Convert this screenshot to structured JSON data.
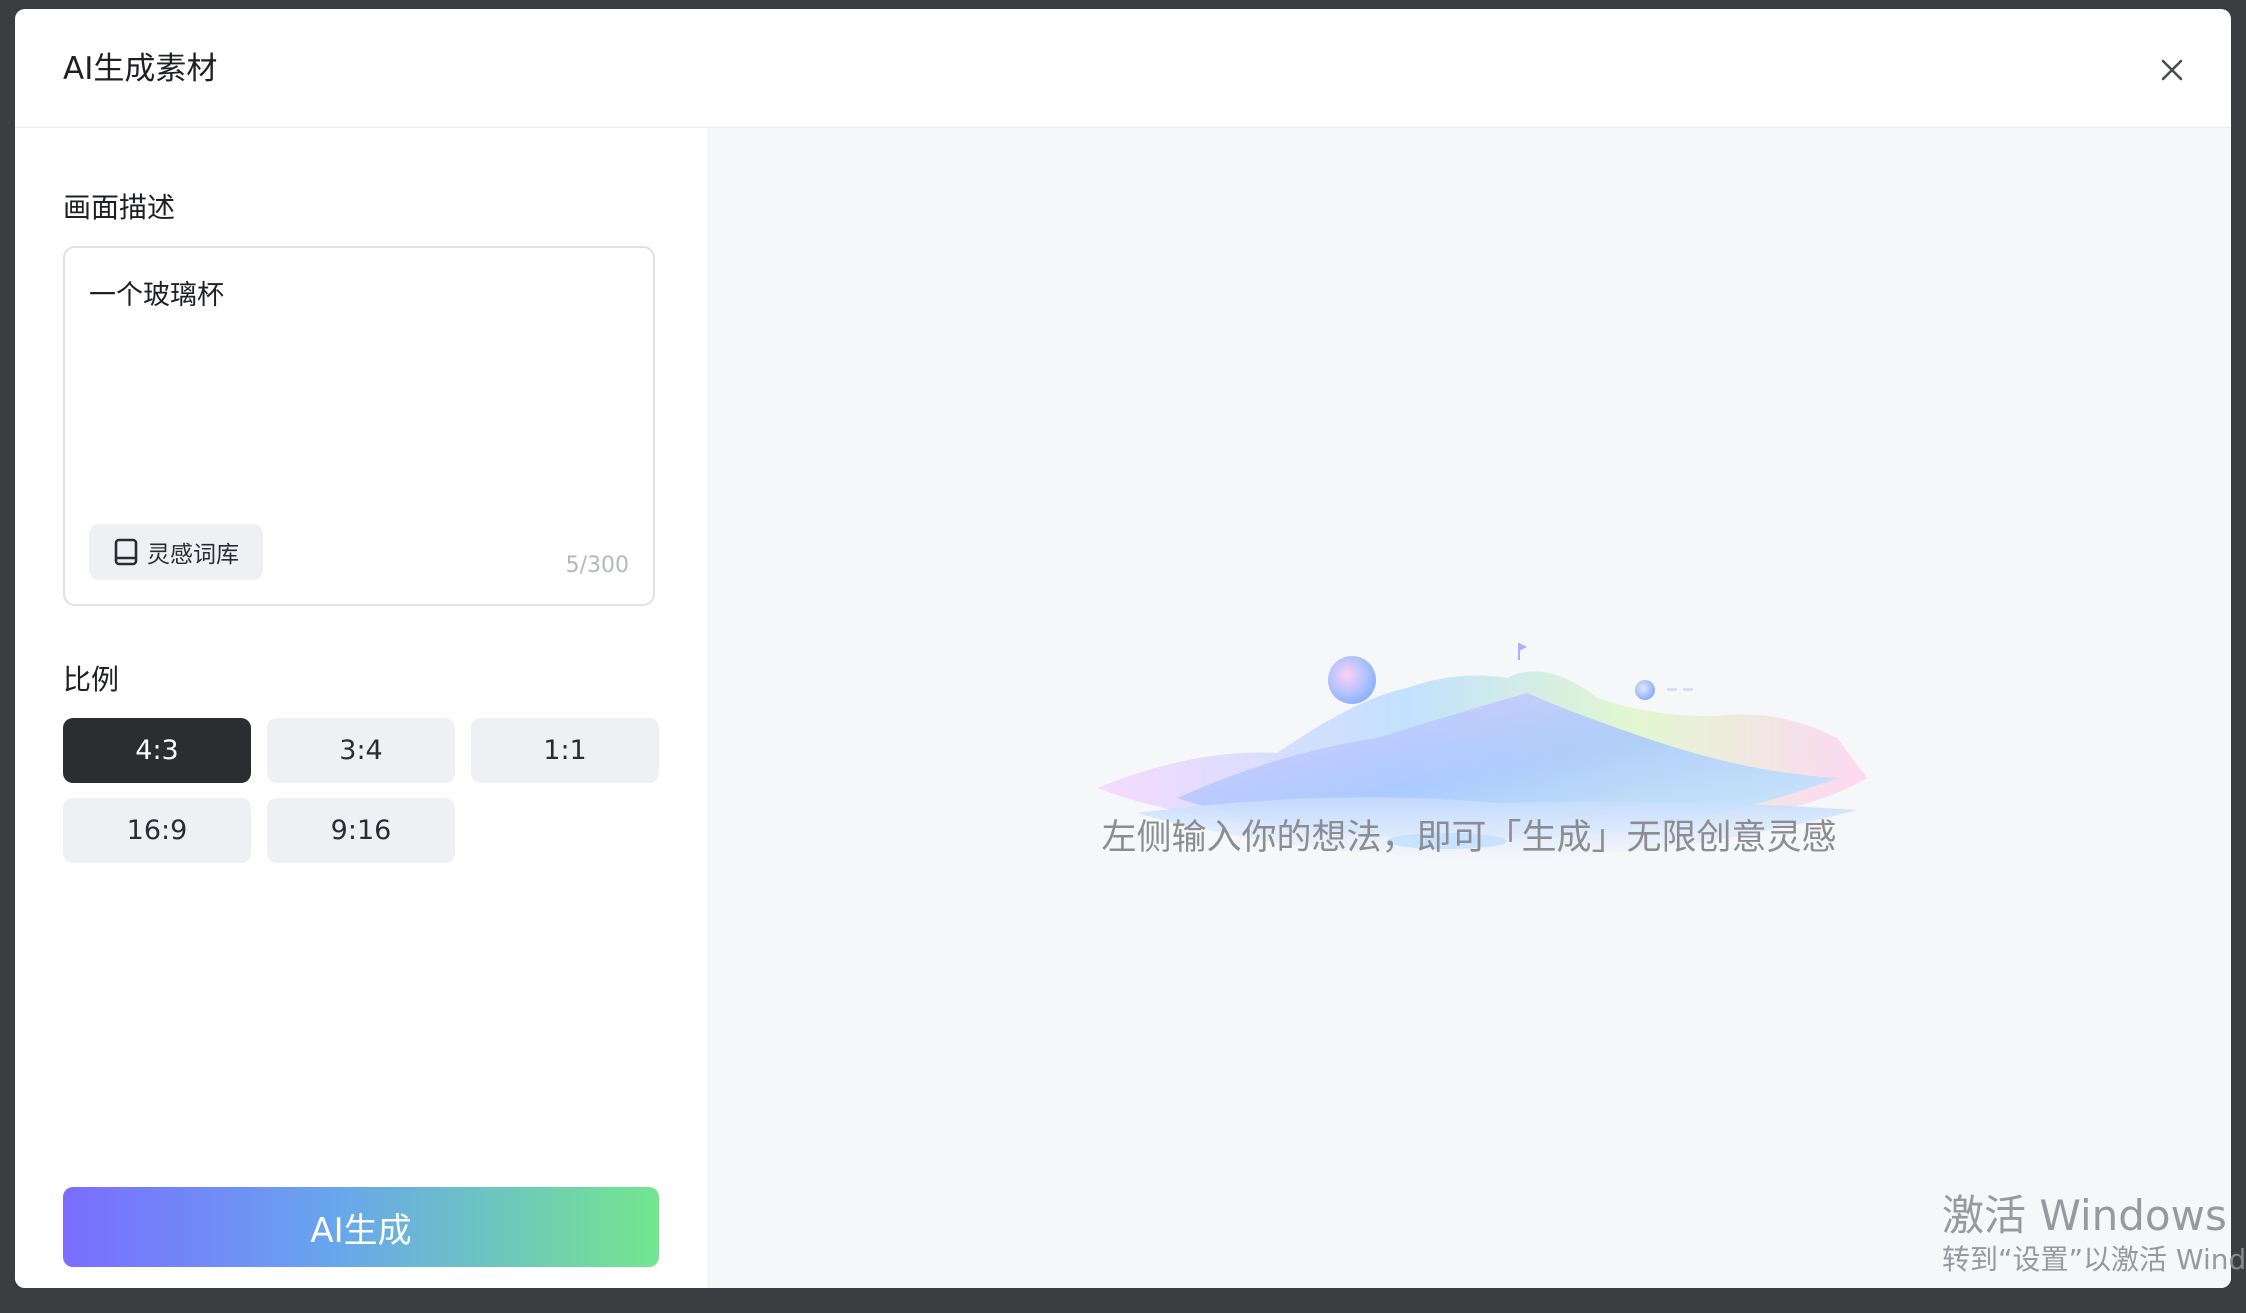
{
  "dialog": {
    "title": "AI生成素材",
    "close_icon": "close-icon"
  },
  "left": {
    "description_label": "画面描述",
    "description_value": "一个玻璃杯",
    "inspiration_button": {
      "label": "灵感词库",
      "icon": "book-icon"
    },
    "char_count": "5/300",
    "ratio_label": "比例",
    "ratios": [
      {
        "label": "4:3",
        "selected": true
      },
      {
        "label": "3:4",
        "selected": false
      },
      {
        "label": "1:1",
        "selected": false
      },
      {
        "label": "16:9",
        "selected": false
      },
      {
        "label": "9:16",
        "selected": false
      }
    ],
    "generate_button": "AI生成"
  },
  "right": {
    "empty_hint": "左侧输入你的想法，即可「生成」无限创意灵感"
  },
  "watermark": {
    "title": "激活 Windows",
    "subtitle": "转到“设置”以激活 Windo"
  },
  "colors": {
    "primary_dark": "#2b2d31",
    "gradient_start": "#7b6cff",
    "gradient_mid": "#68a5ee",
    "gradient_end": "#73e68f",
    "panel_bg": "#f6f7f9"
  }
}
